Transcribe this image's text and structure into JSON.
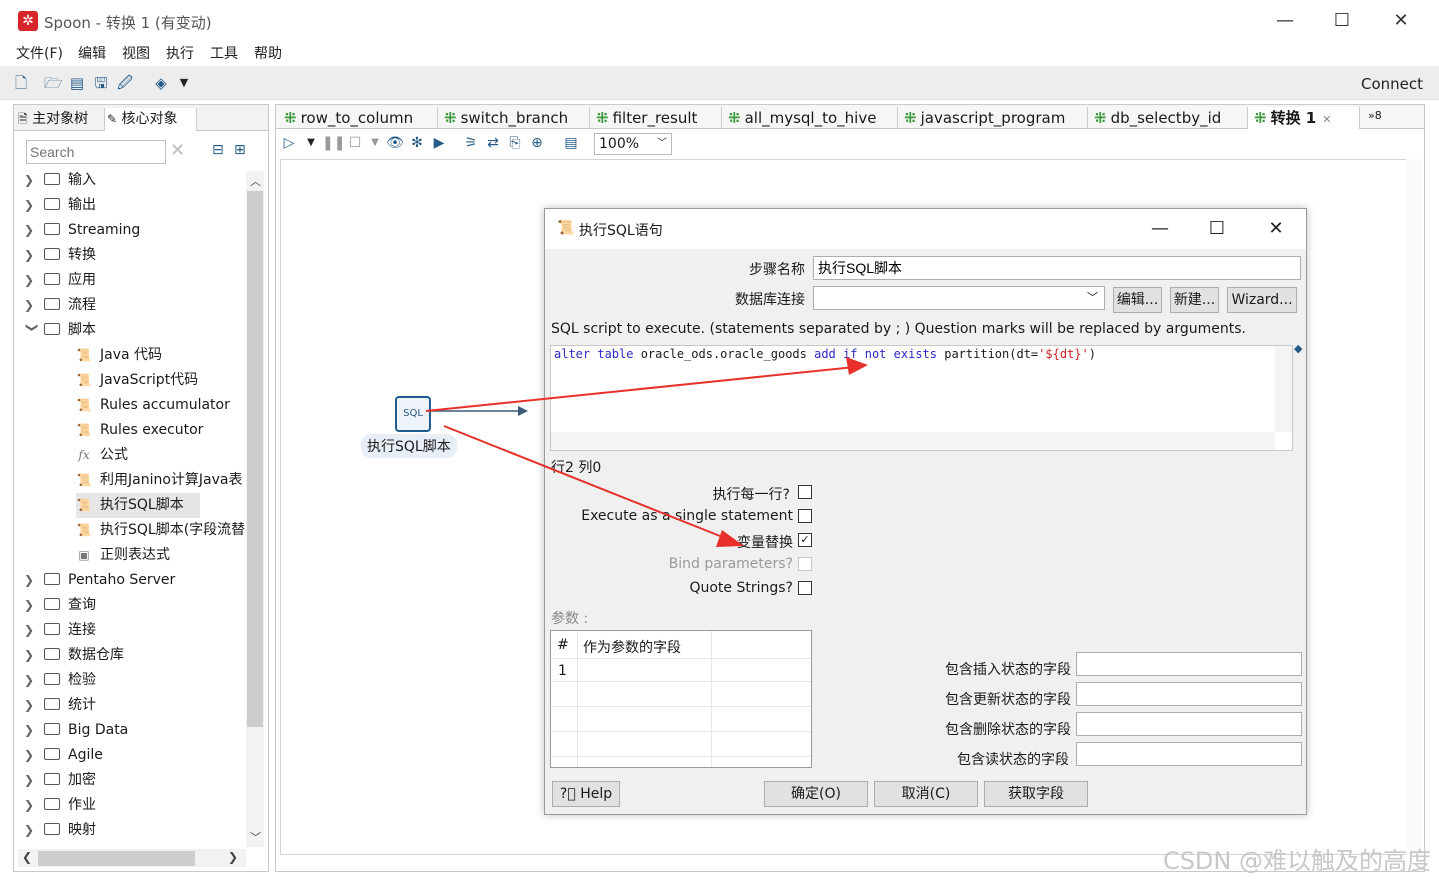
{
  "window": {
    "title": "Spoon - 转换 1 (有变动)",
    "minimize": "—",
    "maximize": "☐",
    "close": "✕"
  },
  "menu": [
    "文件(F)",
    "编辑",
    "视图",
    "执行",
    "工具",
    "帮助"
  ],
  "toolbar": {
    "connect": "Connect"
  },
  "left_panel": {
    "tabs": [
      "主对象树",
      "核心对象"
    ],
    "search_placeholder": "Search",
    "tree": [
      {
        "label": "输入",
        "expanded": false
      },
      {
        "label": "输出",
        "expanded": false
      },
      {
        "label": "Streaming",
        "expanded": false
      },
      {
        "label": "转换",
        "expanded": false
      },
      {
        "label": "应用",
        "expanded": false
      },
      {
        "label": "流程",
        "expanded": false
      },
      {
        "label": "脚本",
        "expanded": true
      },
      {
        "label": "Pentaho Server",
        "expanded": false
      },
      {
        "label": "查询",
        "expanded": false
      },
      {
        "label": "连接",
        "expanded": false
      },
      {
        "label": "数据仓库",
        "expanded": false
      },
      {
        "label": "检验",
        "expanded": false
      },
      {
        "label": "统计",
        "expanded": false
      },
      {
        "label": "Big Data",
        "expanded": false
      },
      {
        "label": "Agile",
        "expanded": false
      },
      {
        "label": "加密",
        "expanded": false
      },
      {
        "label": "作业",
        "expanded": false
      },
      {
        "label": "映射",
        "expanded": false
      }
    ],
    "script_children": [
      {
        "label": "Java 代码",
        "icon": "script-icon"
      },
      {
        "label": "JavaScript代码",
        "icon": "script-icon"
      },
      {
        "label": "Rules accumulator",
        "icon": "script-icon"
      },
      {
        "label": "Rules executor",
        "icon": "script-icon"
      },
      {
        "label": "公式",
        "icon": "fx-icon"
      },
      {
        "label": "利用Janino计算Java表",
        "icon": "script-icon"
      },
      {
        "label": "执行SQL脚本",
        "icon": "sql-icon",
        "selected": true
      },
      {
        "label": "执行SQL脚本(字段流替",
        "icon": "sql-icon"
      },
      {
        "label": "正则表达式",
        "icon": "regex-icon"
      }
    ]
  },
  "editor": {
    "tabs": [
      {
        "label": "row_to_column"
      },
      {
        "label": "switch_branch"
      },
      {
        "label": "filter_result"
      },
      {
        "label": "all_mysql_to_hive"
      },
      {
        "label": "javascript_program"
      },
      {
        "label": "db_selectby_id"
      },
      {
        "label": "转换 1",
        "active": true
      }
    ],
    "overflow": "»8",
    "zoom": "100%",
    "step_node": {
      "label": "执行SQL脚本",
      "icon_text": "SQL"
    }
  },
  "dialog": {
    "title": "执行SQL语句",
    "step_name_label": "步骤名称",
    "step_name_value": "执行SQL脚本",
    "db_conn_label": "数据库连接",
    "btn_edit": "编辑...",
    "btn_new": "新建...",
    "btn_wizard": "Wizard...",
    "sql_label": "SQL script to execute. (statements separated by ; ) Question marks will be replaced by arguments.",
    "sql_tokens": [
      "alter",
      " ",
      "table",
      " oracle_ods.oracle_goods ",
      "add",
      " ",
      "if",
      " ",
      "not",
      " ",
      "exists",
      " partition(dt=",
      "'${dt}'",
      ")"
    ],
    "position": "行2 列0",
    "checkboxes": [
      {
        "label": "执行每一行?",
        "checked": false,
        "enabled": true
      },
      {
        "label": "Execute as a single statement",
        "checked": false,
        "enabled": true
      },
      {
        "label": "变量替换",
        "checked": true,
        "enabled": true
      },
      {
        "label": "Bind parameters?",
        "checked": false,
        "enabled": false
      },
      {
        "label": "Quote Strings?",
        "checked": false,
        "enabled": true
      }
    ],
    "params_label": "参数 :",
    "param_table": {
      "headers": [
        "#",
        "作为参数的字段"
      ],
      "rows": [
        [
          "1",
          ""
        ]
      ]
    },
    "status_fields": [
      "包含插入状态的字段",
      "包含更新状态的字段",
      "包含删除状态的字段",
      "包含读状态的字段"
    ],
    "btn_help": "Help",
    "btn_ok": "确定(O)",
    "btn_cancel": "取消(C)",
    "btn_get_fields": "获取字段"
  },
  "watermark": "CSDN @难以触及的高度"
}
